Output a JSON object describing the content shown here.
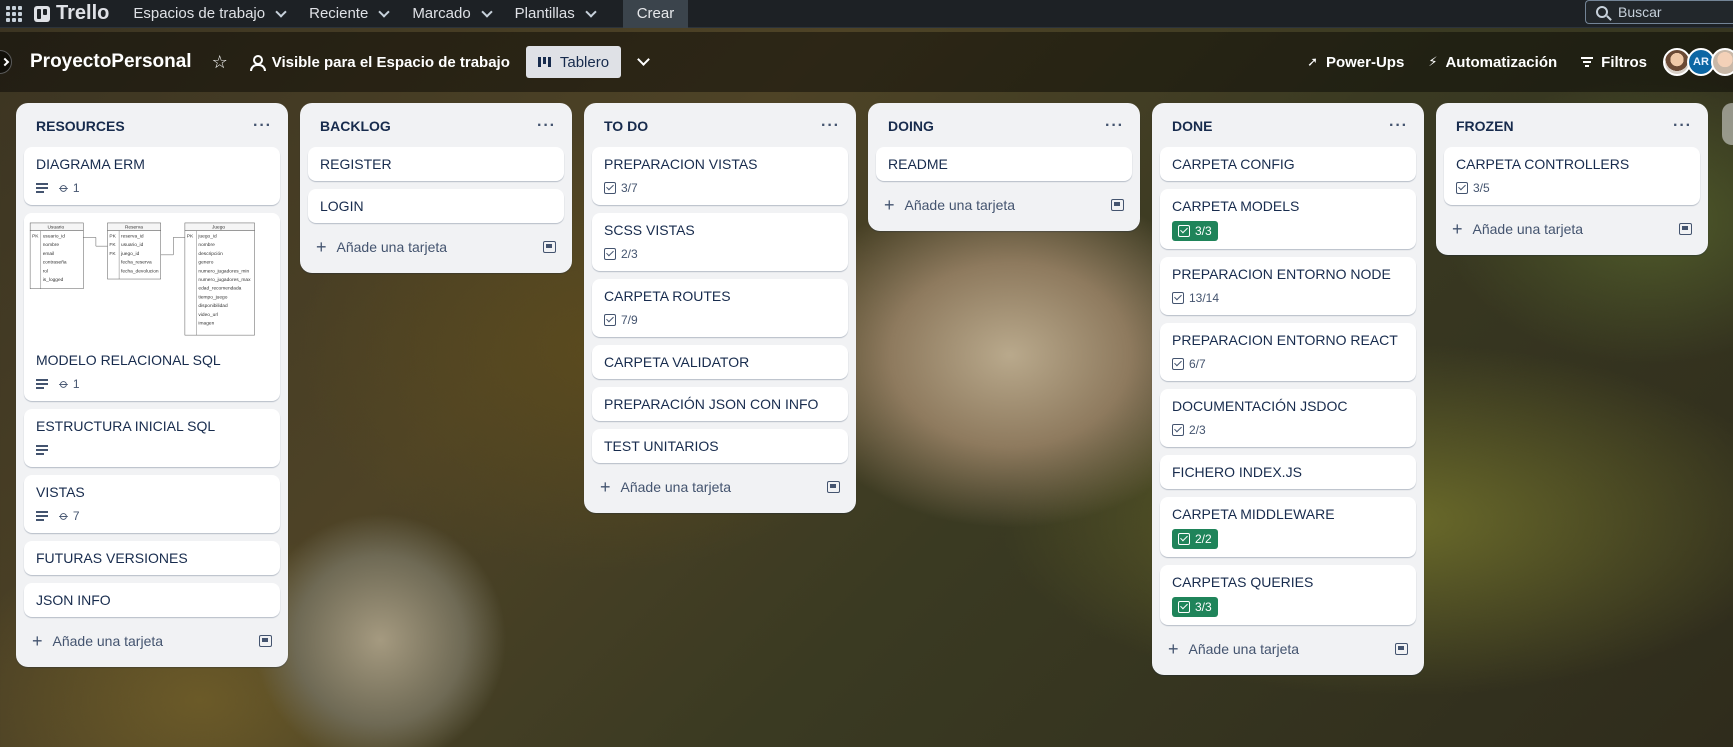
{
  "nav": {
    "brand": "Trello",
    "items": [
      {
        "label": "Espacios de trabajo"
      },
      {
        "label": "Reciente"
      },
      {
        "label": "Marcado"
      },
      {
        "label": "Plantillas"
      }
    ],
    "create_label": "Crear",
    "search_placeholder": "Buscar"
  },
  "board": {
    "title": "ProyectoPersonal",
    "visibility": "Visible para el Espacio de trabajo",
    "view_label": "Tablero",
    "powerups": "Power-Ups",
    "automation": "Automatización",
    "filters": "Filtros",
    "avatars": [
      {
        "initials": ""
      },
      {
        "initials": "AR"
      },
      {
        "initials": ""
      }
    ]
  },
  "add_card_label": "Añade una tarjeta",
  "colors": {
    "nav_bg": "#1d2125",
    "list_bg": "#f1f2f4",
    "complete_green": "#1f845a",
    "text": "#172b4d"
  },
  "erm_diagram": {
    "tables": [
      {
        "name": "Usuario",
        "rows": [
          "usuario_id",
          "nombre",
          "email",
          "contraseña",
          "rol",
          "is_logged"
        ]
      },
      {
        "name": "Reserva",
        "rows": [
          "reserva_id",
          "usuario_id",
          "juego_id",
          "fecha_reserva",
          "fecha_devolucion"
        ]
      },
      {
        "name": "Juego",
        "rows": [
          "juego_id",
          "nombre",
          "descripción",
          "genero",
          "numero_jugadores_min",
          "numero_jugadores_max",
          "edad_recomendada",
          "tiempo_juego",
          "disponibilidad",
          "video_url",
          "imagen"
        ]
      }
    ]
  },
  "lists": [
    {
      "title": "RESOURCES",
      "cards": [
        {
          "title": "DIAGRAMA ERM",
          "desc": true,
          "attachments": "1"
        },
        {
          "title": "MODELO RELACIONAL SQL",
          "desc": true,
          "attachments": "1",
          "cover": true
        },
        {
          "title": "ESTRUCTURA INICIAL SQL",
          "desc": true
        },
        {
          "title": "VISTAS",
          "desc": true,
          "attachments": "7"
        },
        {
          "title": "FUTURAS VERSIONES"
        },
        {
          "title": "JSON INFO"
        }
      ]
    },
    {
      "title": "BACKLOG",
      "cards": [
        {
          "title": "REGISTER"
        },
        {
          "title": "LOGIN"
        }
      ]
    },
    {
      "title": "TO DO",
      "cards": [
        {
          "title": "PREPARACION VISTAS",
          "checklist": "3/7"
        },
        {
          "title": "SCSS VISTAS",
          "checklist": "2/3"
        },
        {
          "title": "CARPETA ROUTES",
          "checklist": "7/9"
        },
        {
          "title": "CARPETA VALIDATOR"
        },
        {
          "title": "PREPARACIÓN JSON CON INFO"
        },
        {
          "title": "TEST UNITARIOS"
        }
      ]
    },
    {
      "title": "DOING",
      "cards": [
        {
          "title": "README"
        }
      ]
    },
    {
      "title": "DONE",
      "cards": [
        {
          "title": "CARPETA CONFIG"
        },
        {
          "title": "CARPETA MODELS",
          "checklist": "3/3",
          "complete": true
        },
        {
          "title": "PREPARACION ENTORNO NODE",
          "checklist": "13/14"
        },
        {
          "title": "PREPARACION ENTORNO REACT",
          "checklist": "6/7"
        },
        {
          "title": "DOCUMENTACIÓN JSDOC",
          "checklist": "2/3"
        },
        {
          "title": "FICHERO INDEX.JS"
        },
        {
          "title": "CARPETA MIDDLEWARE",
          "checklist": "2/2",
          "complete": true
        },
        {
          "title": "CARPETAS QUERIES",
          "checklist": "3/3",
          "complete": true
        }
      ]
    },
    {
      "title": "FROZEN",
      "cards": [
        {
          "title": "CARPETA CONTROLLERS",
          "checklist": "3/5"
        }
      ]
    }
  ]
}
